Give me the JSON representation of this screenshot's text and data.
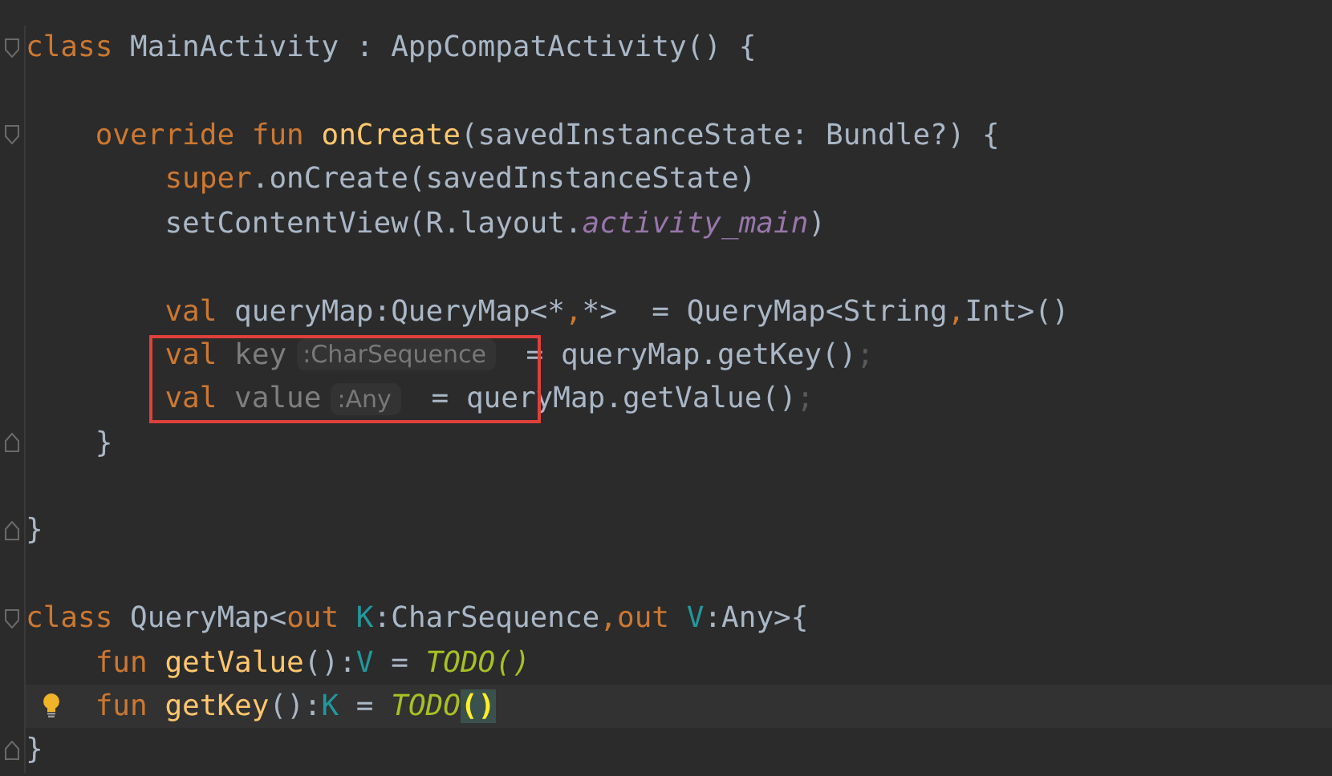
{
  "editor": {
    "lines": [
      {
        "fold_start": true,
        "fold_end": false,
        "current": false,
        "bulb": false,
        "boxed": false,
        "tokens": [
          {
            "kind": "keyword",
            "text": "class"
          },
          {
            "kind": "plain",
            "text": " MainActivity : AppCompatActivity() {"
          }
        ],
        "children": [
          {
            "fold_start": false,
            "fold_end": false,
            "current": false,
            "bulb": false,
            "boxed": false
          },
          {
            "fold_start": true,
            "fold_end": false,
            "current": false,
            "bulb": false,
            "boxed": false,
            "tokens": [
              {
                "kind": "keyword",
                "text": "override fun "
              },
              {
                "kind": "declaration",
                "text": "onCreate"
              },
              {
                "kind": "plain",
                "text": "(savedInstanceState: Bundle?) {"
              }
            ],
            "children": [
              {
                "fold_start": false,
                "fold_end": false,
                "current": false,
                "bulb": false,
                "boxed": false,
                "tokens": [
                  {
                    "kind": "keyword",
                    "text": "super"
                  },
                  {
                    "kind": "plain",
                    "text": ".onCreate(savedInstanceState)"
                  }
                ]
              },
              {
                "fold_start": false,
                "fold_end": false,
                "current": false,
                "bulb": false,
                "boxed": false,
                "tokens": [
                  {
                    "kind": "plain",
                    "text": "setContentView(R.layout."
                  },
                  {
                    "kind": "field",
                    "text": "activity_main"
                  },
                  {
                    "kind": "plain",
                    "text": ")"
                  }
                ]
              },
              {
                "fold_start": false,
                "fold_end": false,
                "current": false,
                "bulb": false,
                "boxed": false
              },
              {
                "fold_start": false,
                "fold_end": false,
                "current": false,
                "bulb": false,
                "boxed": false,
                "tokens": [
                  {
                    "kind": "keyword",
                    "text": "val "
                  },
                  {
                    "kind": "plain",
                    "text": "queryMap:QueryMap<*"
                  },
                  {
                    "kind": "keyword",
                    "text": ","
                  },
                  {
                    "kind": "plain",
                    "text": "*>  = QueryMap<String"
                  },
                  {
                    "kind": "keyword",
                    "text": ","
                  },
                  {
                    "kind": "plain",
                    "text": "Int>()"
                  }
                ]
              },
              {
                "fold_start": false,
                "fold_end": false,
                "current": false,
                "bulb": false,
                "boxed": true,
                "tokens": [
                  {
                    "kind": "keyword",
                    "text": "val "
                  },
                  {
                    "kind": "unused",
                    "text": "key"
                  },
                  {
                    "kind": "hint",
                    "text": ":CharSequence"
                  },
                  {
                    "kind": "plain",
                    "text": " = queryMap.getKey()"
                  },
                  {
                    "kind": "dim",
                    "text": ";"
                  }
                ]
              },
              {
                "fold_start": false,
                "fold_end": false,
                "current": false,
                "bulb": false,
                "boxed": true,
                "tokens": [
                  {
                    "kind": "keyword",
                    "text": "val "
                  },
                  {
                    "kind": "unused",
                    "text": "value"
                  },
                  {
                    "kind": "hint",
                    "text": ":Any"
                  },
                  {
                    "kind": "plain",
                    "text": " = queryMap.getValue()"
                  },
                  {
                    "kind": "dim",
                    "text": ";"
                  }
                ]
              }
            ]
          },
          {
            "fold_start": false,
            "fold_end": true,
            "current": false,
            "bulb": false,
            "boxed": false,
            "tokens": [
              {
                "kind": "plain",
                "text": "}"
              }
            ]
          },
          {
            "fold_start": false,
            "fold_end": false,
            "current": false,
            "bulb": false,
            "boxed": false
          }
        ]
      },
      {
        "fold_start": false,
        "fold_end": true,
        "current": false,
        "bulb": false,
        "boxed": false,
        "tokens": [
          {
            "kind": "plain",
            "text": "}"
          }
        ]
      },
      {
        "fold_start": false,
        "fold_end": false,
        "current": false,
        "bulb": false,
        "boxed": false
      },
      {
        "fold_start": true,
        "fold_end": false,
        "current": false,
        "bulb": false,
        "boxed": false,
        "tokens": [
          {
            "kind": "keyword",
            "text": "class"
          },
          {
            "kind": "plain",
            "text": " QueryMap<"
          },
          {
            "kind": "keyword",
            "text": "out "
          },
          {
            "kind": "type-param",
            "text": "K"
          },
          {
            "kind": "plain",
            "text": ":CharSequence"
          },
          {
            "kind": "keyword",
            "text": ",out "
          },
          {
            "kind": "type-param",
            "text": "V"
          },
          {
            "kind": "plain",
            "text": ":Any>{"
          }
        ],
        "children": [
          {
            "fold_start": false,
            "fold_end": false,
            "current": false,
            "bulb": false,
            "boxed": false,
            "tokens": [
              {
                "kind": "keyword",
                "text": "fun "
              },
              {
                "kind": "declaration",
                "text": "getValue"
              },
              {
                "kind": "plain",
                "text": "():"
              },
              {
                "kind": "type-param",
                "text": "V"
              },
              {
                "kind": "plain",
                "text": " = "
              },
              {
                "kind": "todo",
                "text": "TODO()"
              }
            ]
          },
          {
            "fold_start": false,
            "fold_end": false,
            "current": true,
            "bulb": true,
            "boxed": false,
            "tokens": [
              {
                "kind": "keyword",
                "text": "fun "
              },
              {
                "kind": "declaration",
                "text": "getKey"
              },
              {
                "kind": "plain",
                "text": "():"
              },
              {
                "kind": "type-param",
                "text": "K"
              },
              {
                "kind": "plain",
                "text": " = "
              },
              {
                "kind": "todo",
                "text": "TODO"
              },
              {
                "kind": "brace-match",
                "text": "()"
              }
            ]
          }
        ]
      },
      {
        "fold_start": false,
        "fold_end": true,
        "current": false,
        "bulb": false,
        "boxed": false,
        "tokens": [
          {
            "kind": "plain",
            "text": "}"
          }
        ]
      }
    ]
  }
}
